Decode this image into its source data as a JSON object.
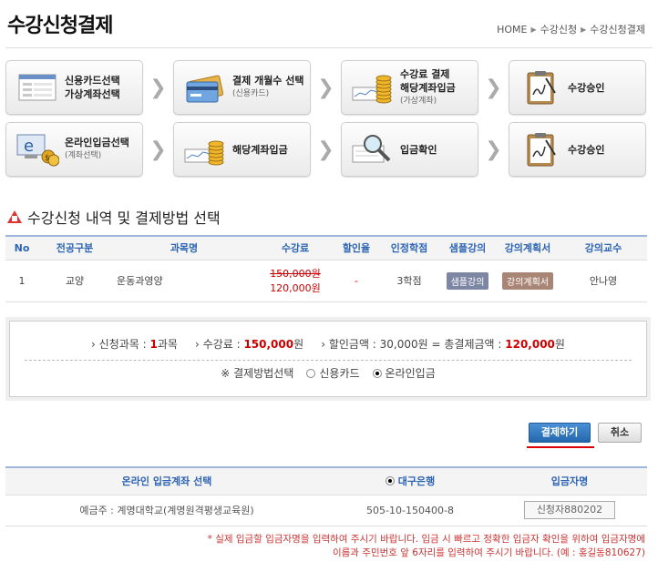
{
  "page": {
    "title": "수강신청결제"
  },
  "breadcrumb": [
    "HOME",
    "수강신청",
    "수강신청결제"
  ],
  "steps_row1": [
    {
      "line1": "신용카드선택",
      "line2": "가상계좌선택",
      "sub": "",
      "icon": "form-icon"
    },
    {
      "line1": "결제 개월수 선택",
      "line2": "",
      "sub": "(신용카드)",
      "icon": "credit-card-icon"
    },
    {
      "line1": "수강료 결제",
      "line2": "해당계좌입금",
      "sub": "(가상계좌)",
      "icon": "coins-chart-icon"
    },
    {
      "line1": "수강승인",
      "line2": "",
      "sub": "",
      "icon": "clipboard-icon"
    }
  ],
  "steps_row2": [
    {
      "line1": "온라인입금선택",
      "line2": "",
      "sub": "(계좌선택)",
      "icon": "online-money-icon"
    },
    {
      "line1": "해당계좌입금",
      "line2": "",
      "sub": "",
      "icon": "coins-chart-icon"
    },
    {
      "line1": "입금확인",
      "line2": "",
      "sub": "",
      "icon": "magnifier-icon"
    },
    {
      "line1": "수강승인",
      "line2": "",
      "sub": "",
      "icon": "clipboard-icon"
    }
  ],
  "section": {
    "title": "수강신청 내역 및 결제방법 선택"
  },
  "course_table": {
    "headers": [
      "No",
      "전공구분",
      "과목명",
      "수강료",
      "할인율",
      "인정학점",
      "샘플강의",
      "강의계획서",
      "강의교수"
    ],
    "rows": [
      {
        "no": "1",
        "type": "교양",
        "subject": "운동과영양",
        "price_old": "150,000원",
        "price_new": "120,000원",
        "discount": "-",
        "credit": "3학점",
        "sample": "샘플강의",
        "plan": "강의계획서",
        "professor": "안나영"
      }
    ]
  },
  "summary": {
    "courses_label": "› 신청과목 : ",
    "courses_value": "1",
    "courses_unit": "과목",
    "fee_label": "› 수강료 : ",
    "fee_value": "150,000",
    "fee_unit": "원",
    "discount_text": "› 할인금액 : 30,000원 = 총결제금액 : ",
    "total_value": "120,000",
    "total_unit": "원",
    "method_label": "※ 결제방법선택",
    "option_card": "신용카드",
    "option_online": "온라인입금",
    "selected": "온라인입금"
  },
  "buttons": {
    "pay": "결제하기",
    "cancel": "취소"
  },
  "bank_table": {
    "headers": [
      "온라인 입금계좌 선택",
      "대구은행",
      "입금자명"
    ],
    "holder": "예금주 : 계명대학교(계명원격평생교육원)",
    "account": "505-10-150400-8",
    "depositor": "신청자880202"
  },
  "notice": {
    "line1": "* 실제 입금할 입금자명을 입력하여 주시기 바랍니다. 입금 시 빠르고 정확한 입금자 확인을 위하여 입금자명에",
    "line2": "이름과 주민번호 앞 6자리를 입력하여 주시기 바랍니다. (예 : 홍길동810627)"
  },
  "colors": {
    "accent": "#2d64b3",
    "alert": "#cc0000",
    "sample_tag": "#7d86a3",
    "plan_tag": "#a98576"
  }
}
